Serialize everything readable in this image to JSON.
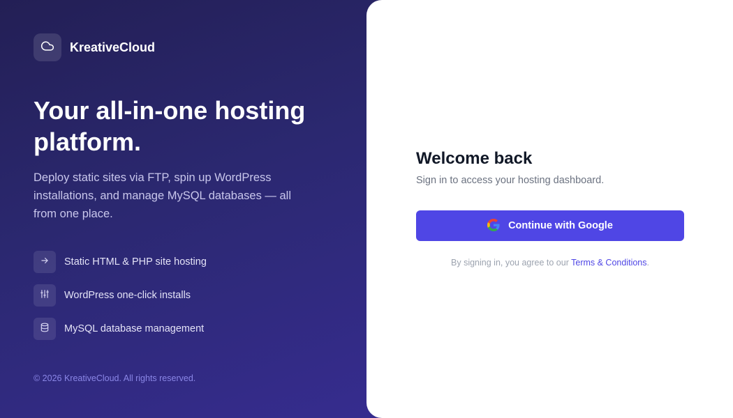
{
  "brand": {
    "name": "KreativeCloud",
    "icon": "cloud-icon"
  },
  "hero": {
    "headline": "Your all-in-one hosting platform.",
    "description": "Deploy static sites via FTP, spin up WordPress installations, and manage MySQL databases — all from one place."
  },
  "features": [
    {
      "icon": "arrow-right-icon",
      "label": "Static HTML & PHP site hosting"
    },
    {
      "icon": "sliders-icon",
      "label": "WordPress one-click installs"
    },
    {
      "icon": "database-icon",
      "label": "MySQL database management"
    }
  ],
  "footer": {
    "copyright": "© 2026 KreativeCloud. All rights reserved."
  },
  "login": {
    "title": "Welcome back",
    "subtitle": "Sign in to access your hosting dashboard.",
    "google_button_label": "Continue with Google",
    "terms_prefix": "By signing in, you agree to our ",
    "terms_link": "Terms & Conditions",
    "terms_suffix": "."
  },
  "colors": {
    "accent": "#4f46e5",
    "panel_dark": "#2b2870",
    "footer_text": "#8a86e6"
  }
}
